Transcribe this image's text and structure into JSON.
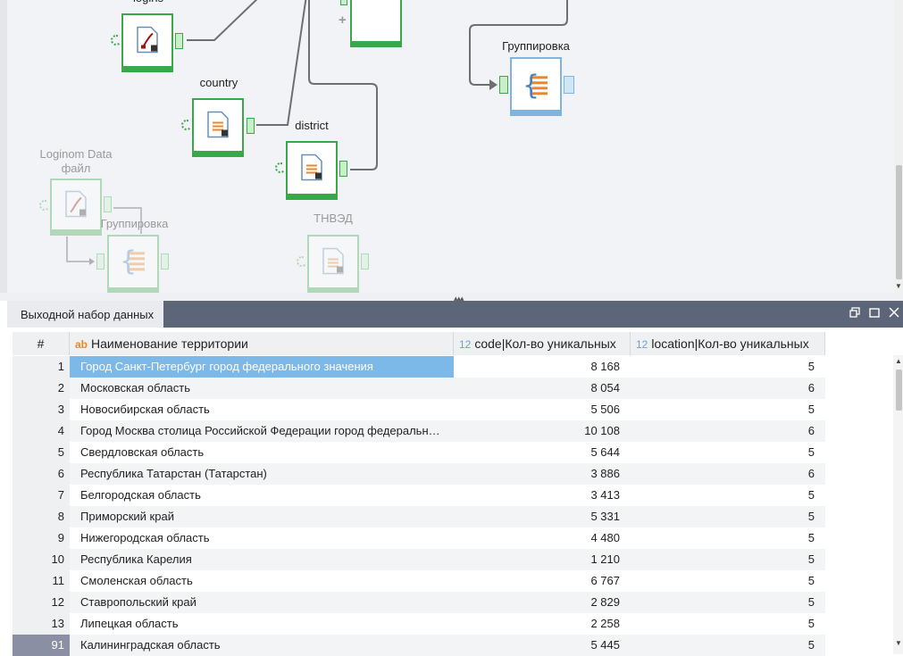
{
  "canvas": {
    "nodes": {
      "logins": "logins",
      "country": "country",
      "district": "district",
      "grouping_main": "Группировка",
      "loginom_file_line1": "Loginom Data",
      "loginom_file_line2": "файл",
      "grouping_faded": "Группировка",
      "tnved": "ТНВЭД"
    },
    "icons": [
      "curve-chart-icon",
      "document-icon",
      "grouping-icon",
      "plus-icon"
    ]
  },
  "panel": {
    "tab_label": "Выходной набор данных",
    "buttons": [
      "restore-icon",
      "maximize-icon",
      "close-icon"
    ]
  },
  "grid": {
    "columns": {
      "num": "#",
      "name_type": "ab",
      "name": "Наименование территории",
      "code_type": "12",
      "code": "code|Кол-во уникальных",
      "loc_type": "12",
      "loc": "location|Кол-во уникальных"
    },
    "rows": [
      {
        "n": "1",
        "name": "Город Санкт-Петербург город федерального значения",
        "code": "8 168",
        "loc": "5"
      },
      {
        "n": "2",
        "name": "Московская область",
        "code": "8 054",
        "loc": "6"
      },
      {
        "n": "3",
        "name": "Новосибирская область",
        "code": "5 506",
        "loc": "5"
      },
      {
        "n": "4",
        "name": "Город Москва столица Российской Федерации город федеральн…",
        "code": "10 108",
        "loc": "6"
      },
      {
        "n": "5",
        "name": "Свердловская область",
        "code": "5 644",
        "loc": "5"
      },
      {
        "n": "6",
        "name": "Республика Татарстан (Татарстан)",
        "code": "3 886",
        "loc": "6"
      },
      {
        "n": "7",
        "name": "Белгородская область",
        "code": "3 413",
        "loc": "5"
      },
      {
        "n": "8",
        "name": "Приморский край",
        "code": "5 331",
        "loc": "5"
      },
      {
        "n": "9",
        "name": "Нижегородская область",
        "code": "4 480",
        "loc": "5"
      },
      {
        "n": "10",
        "name": "Республика Карелия",
        "code": "1 210",
        "loc": "5"
      },
      {
        "n": "11",
        "name": "Смоленская область",
        "code": "6 767",
        "loc": "5"
      },
      {
        "n": "12",
        "name": "Ставропольский край",
        "code": "2 829",
        "loc": "5"
      },
      {
        "n": "13",
        "name": "Липецкая область",
        "code": "2 258",
        "loc": "5"
      },
      {
        "n": "91",
        "name": "Калининградская область",
        "code": "5 445",
        "loc": "5"
      }
    ]
  },
  "colors": {
    "node_green": "#3aa84a",
    "node_blue": "#7fb3e0",
    "header_bar": "#5c6678",
    "selection": "#7cb8e8",
    "current_row": "#8b8fa3"
  }
}
